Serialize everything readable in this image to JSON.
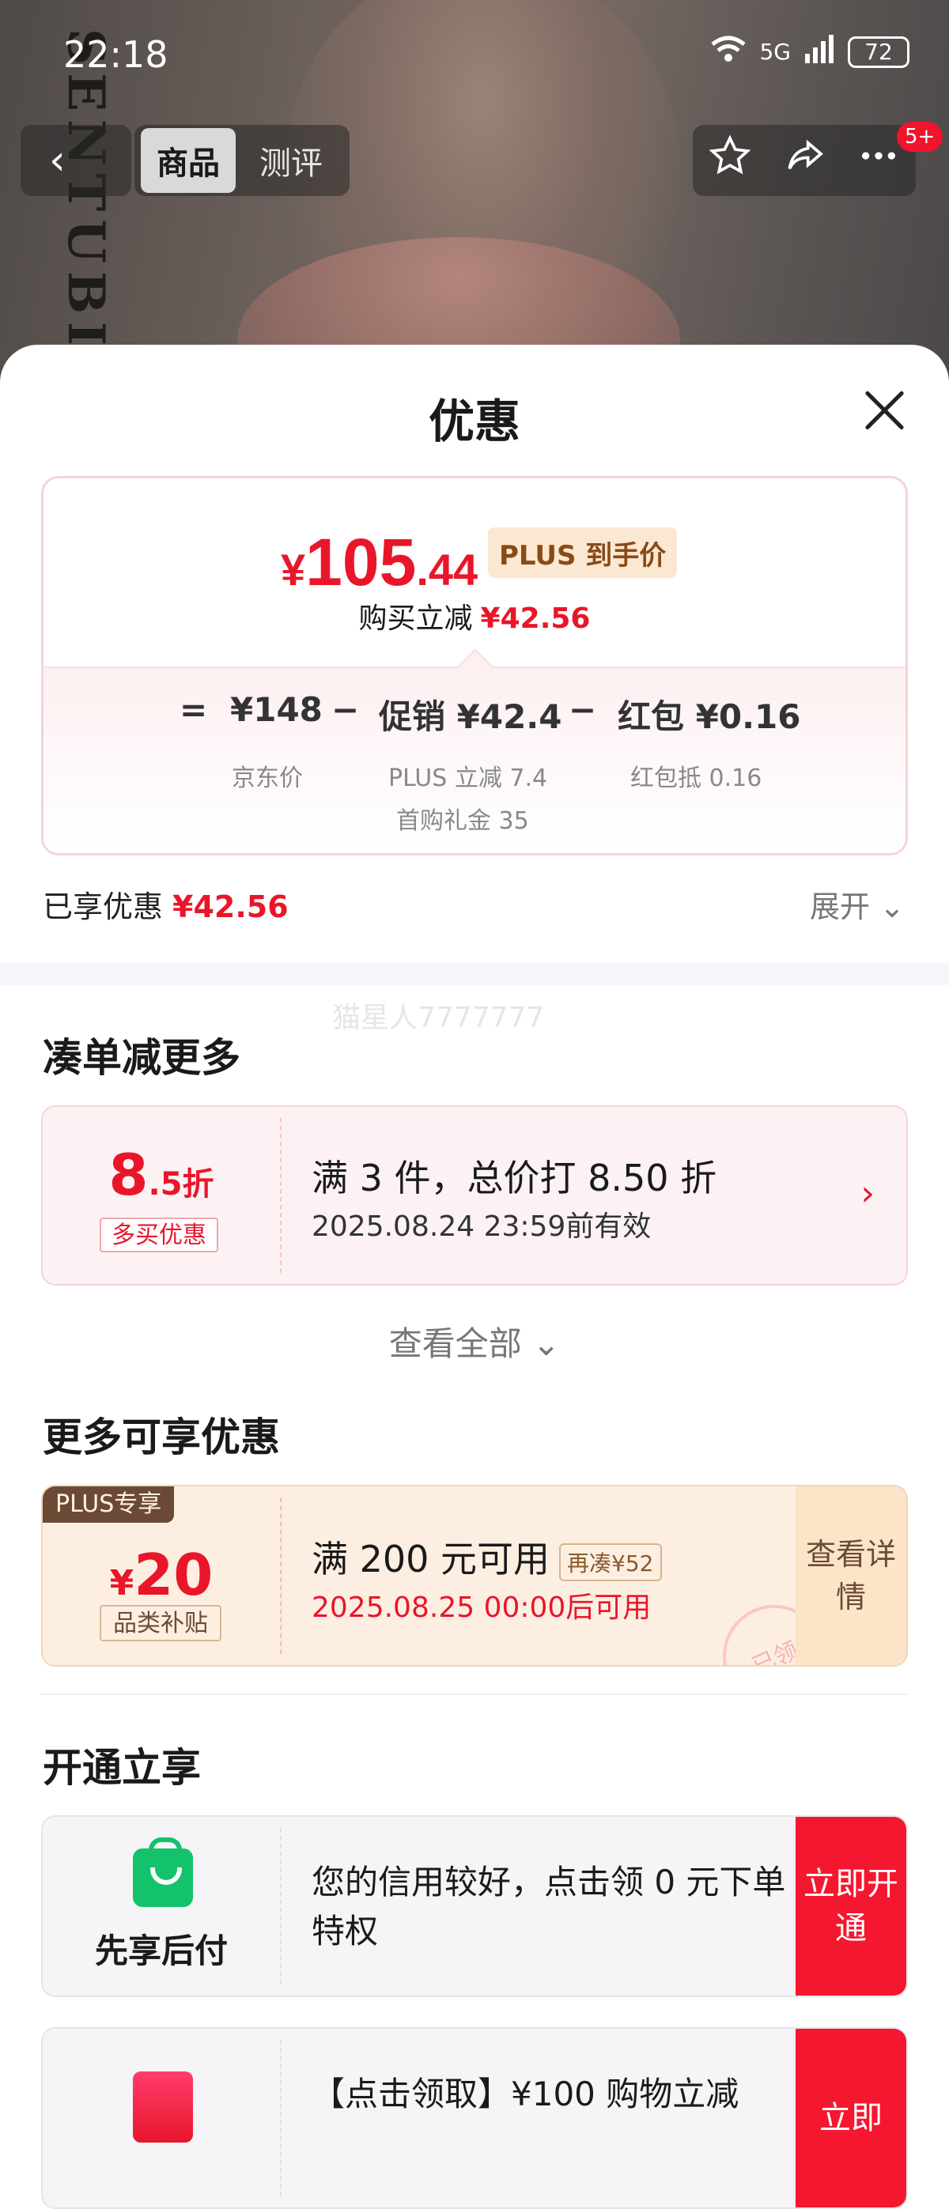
{
  "status_bar": {
    "time": "22:18",
    "network": "5G",
    "battery": "72"
  },
  "nav": {
    "tabs": [
      {
        "label": "商品"
      },
      {
        "label": "测评"
      }
    ],
    "badge": "5+",
    "brand_vertical": "SENTUBILA"
  },
  "sheet": {
    "title": "优惠",
    "price": {
      "symbol": "¥",
      "integer": "105",
      "decimal": ".44",
      "tag": "PLUS 到手价",
      "reduce_label": "购买立减",
      "reduce_amount": "¥42.56"
    },
    "formula": {
      "equals": "=",
      "base": "¥148",
      "minus1": "−",
      "promo": "促销 ¥42.4",
      "minus2": "−",
      "redpacket": "红包 ¥0.16",
      "base_label": "京东价",
      "promo_label1": "PLUS 立减 7.4",
      "promo_label2": "首购礼金 35",
      "redpacket_label": "红包抵 0.16"
    },
    "enjoyed_label": "已享优惠",
    "enjoyed_amount": "¥42.56",
    "expand_label": "展开",
    "watermark": "猫星人7777777"
  },
  "section_more_items": {
    "title": "凑单减更多",
    "coupon": {
      "discount_big": "8",
      "discount_small": ".5折",
      "tag": "多买优惠",
      "main_text": "满 3 件，总价打 8.50 折",
      "sub_text": "2025.08.24 23:59前有效"
    },
    "view_all": "查看全部"
  },
  "section_more_offers": {
    "title": "更多可享优惠",
    "coupon": {
      "ribbon": "PLUS专享",
      "symbol": "¥",
      "amount": "20",
      "tag": "品类补贴",
      "main_text": "满 200 元可用",
      "pill": "再凑¥52",
      "sub_text": "2025.08.25 00:00后可用",
      "action": "查看详情",
      "stamp": "已领"
    }
  },
  "section_open": {
    "title": "开通立享",
    "card1": {
      "brand": "先享后付",
      "text": "您的信用较好，点击领 0 元下单特权",
      "action": "立即开通"
    },
    "card2": {
      "text": "【点击领取】¥100 购物立减",
      "action": "立即"
    }
  }
}
